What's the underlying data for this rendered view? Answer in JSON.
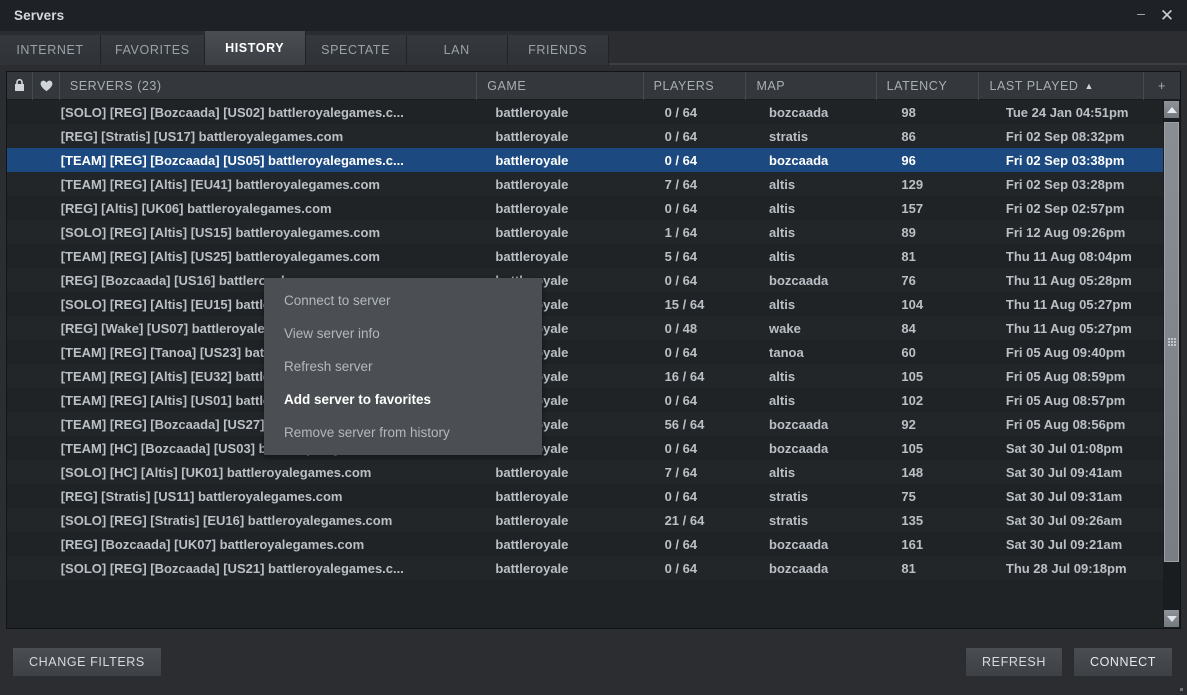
{
  "window": {
    "title": "Servers",
    "minimize_label": "–",
    "close_label": "✕"
  },
  "tabs": [
    {
      "id": "internet",
      "label": "INTERNET",
      "active": false
    },
    {
      "id": "favorites",
      "label": "FAVORITES",
      "active": false
    },
    {
      "id": "history",
      "label": "HISTORY",
      "active": true
    },
    {
      "id": "spectate",
      "label": "SPECTATE",
      "active": false
    },
    {
      "id": "lan",
      "label": "LAN",
      "active": false
    },
    {
      "id": "friends",
      "label": "FRIENDS",
      "active": false
    }
  ],
  "columns": {
    "lock_icon": "lock-icon",
    "heart_icon": "heart-icon",
    "servers": "SERVERS (23)",
    "game": "GAME",
    "players": "PLAYERS",
    "map": "MAP",
    "latency": "LATENCY",
    "last_played": "LAST PLAYED",
    "sort_arrow": "▲",
    "add_column": "+"
  },
  "rows": [
    {
      "name": "[SOLO] [REG] [Bozcaada] [US02] battleroyalegames.c...",
      "game": "battleroyale",
      "players": "0 / 64",
      "map": "bozcaada",
      "latency": "98",
      "last": "Tue 24 Jan 04:51pm",
      "selected": false
    },
    {
      "name": "[REG] [Stratis] [US17] battleroyalegames.com",
      "game": "battleroyale",
      "players": "0 / 64",
      "map": "stratis",
      "latency": "86",
      "last": "Fri 02 Sep 08:32pm",
      "selected": false
    },
    {
      "name": "[TEAM] [REG] [Bozcaada] [US05] battleroyalegames.c...",
      "game": "battleroyale",
      "players": "0 / 64",
      "map": "bozcaada",
      "latency": "96",
      "last": "Fri 02 Sep 03:38pm",
      "selected": true
    },
    {
      "name": "[TEAM] [REG] [Altis] [EU41] battleroyalegames.com",
      "game": "battleroyale",
      "players": "7 / 64",
      "map": "altis",
      "latency": "129",
      "last": "Fri 02 Sep 03:28pm",
      "selected": false
    },
    {
      "name": "[REG] [Altis] [UK06] battleroyalegames.com",
      "game": "battleroyale",
      "players": "0 / 64",
      "map": "altis",
      "latency": "157",
      "last": "Fri 02 Sep 02:57pm",
      "selected": false
    },
    {
      "name": "[SOLO] [REG] [Altis] [US15] battleroyalegames.com",
      "game": "battleroyale",
      "players": "1 / 64",
      "map": "altis",
      "latency": "89",
      "last": "Fri 12 Aug 09:26pm",
      "selected": false
    },
    {
      "name": "[TEAM] [REG] [Altis] [US25] battleroyalegames.com",
      "game": "battleroyale",
      "players": "5 / 64",
      "map": "altis",
      "latency": "81",
      "last": "Thu 11 Aug 08:04pm",
      "selected": false
    },
    {
      "name": "[REG] [Bozcaada] [US16] battleroyalegames.com",
      "game": "battleroyale",
      "players": "0 / 64",
      "map": "bozcaada",
      "latency": "76",
      "last": "Thu 11 Aug 05:28pm",
      "selected": false
    },
    {
      "name": "[SOLO] [REG] [Altis] [EU15] battleroyalegames.com",
      "game": "battleroyale",
      "players": "15 / 64",
      "map": "altis",
      "latency": "104",
      "last": "Thu 11 Aug 05:27pm",
      "selected": false
    },
    {
      "name": "[REG] [Wake] [US07] battleroyalegames.com",
      "game": "battleroyale",
      "players": "0 / 48",
      "map": "wake",
      "latency": "84",
      "last": "Thu 11 Aug 05:27pm",
      "selected": false
    },
    {
      "name": "[TEAM] [REG] [Tanoa] [US23] battleroyalegames.com",
      "game": "battleroyale",
      "players": "0 / 64",
      "map": "tanoa",
      "latency": "60",
      "last": "Fri 05 Aug 09:40pm",
      "selected": false
    },
    {
      "name": "[TEAM] [REG] [Altis] [EU32] battleroyalegames.com",
      "game": "battleroyale",
      "players": "16 / 64",
      "map": "altis",
      "latency": "105",
      "last": "Fri 05 Aug 08:59pm",
      "selected": false
    },
    {
      "name": "[TEAM] [REG] [Altis] [US01] battleroyalegames.com",
      "game": "battleroyale",
      "players": "0 / 64",
      "map": "altis",
      "latency": "102",
      "last": "Fri 05 Aug 08:57pm",
      "selected": false
    },
    {
      "name": "[TEAM] [REG] [Bozcaada] [US27] battleroyalegames.c...",
      "game": "battleroyale",
      "players": "56 / 64",
      "map": "bozcaada",
      "latency": "92",
      "last": "Fri 05 Aug 08:56pm",
      "selected": false
    },
    {
      "name": "[TEAM] [HC] [Bozcaada] [US03] battleroyalegames.com",
      "game": "battleroyale",
      "players": "0 / 64",
      "map": "bozcaada",
      "latency": "105",
      "last": "Sat 30 Jul 01:08pm",
      "selected": false
    },
    {
      "name": "[SOLO] [HC] [Altis] [UK01] battleroyalegames.com",
      "game": "battleroyale",
      "players": "7 / 64",
      "map": "altis",
      "latency": "148",
      "last": "Sat 30 Jul 09:41am",
      "selected": false
    },
    {
      "name": "[REG] [Stratis] [US11] battleroyalegames.com",
      "game": "battleroyale",
      "players": "0 / 64",
      "map": "stratis",
      "latency": "75",
      "last": "Sat 30 Jul 09:31am",
      "selected": false
    },
    {
      "name": "[SOLO] [REG] [Stratis] [EU16] battleroyalegames.com",
      "game": "battleroyale",
      "players": "21 / 64",
      "map": "stratis",
      "latency": "135",
      "last": "Sat 30 Jul 09:26am",
      "selected": false
    },
    {
      "name": "[REG] [Bozcaada] [UK07] battleroyalegames.com",
      "game": "battleroyale",
      "players": "0 / 64",
      "map": "bozcaada",
      "latency": "161",
      "last": "Sat 30 Jul 09:21am",
      "selected": false
    },
    {
      "name": "[SOLO] [REG] [Bozcaada] [US21] battleroyalegames.c...",
      "game": "battleroyale",
      "players": "0 / 64",
      "map": "bozcaada",
      "latency": "81",
      "last": "Thu 28 Jul 09:18pm",
      "selected": false
    }
  ],
  "context_menu": [
    {
      "label": "Connect to server",
      "highlighted": false
    },
    {
      "label": "View server info",
      "highlighted": false
    },
    {
      "label": "Refresh server",
      "highlighted": false
    },
    {
      "label": "Add server to favorites",
      "highlighted": true
    },
    {
      "label": "Remove server from history",
      "highlighted": false
    }
  ],
  "footer": {
    "change_filters": "CHANGE FILTERS",
    "refresh": "REFRESH",
    "connect": "CONNECT"
  },
  "colors": {
    "selection_blue": "#1c4a80",
    "panel_bg": "#202326",
    "menu_bg": "#4b4f53",
    "accent_text": "#ffffff"
  }
}
